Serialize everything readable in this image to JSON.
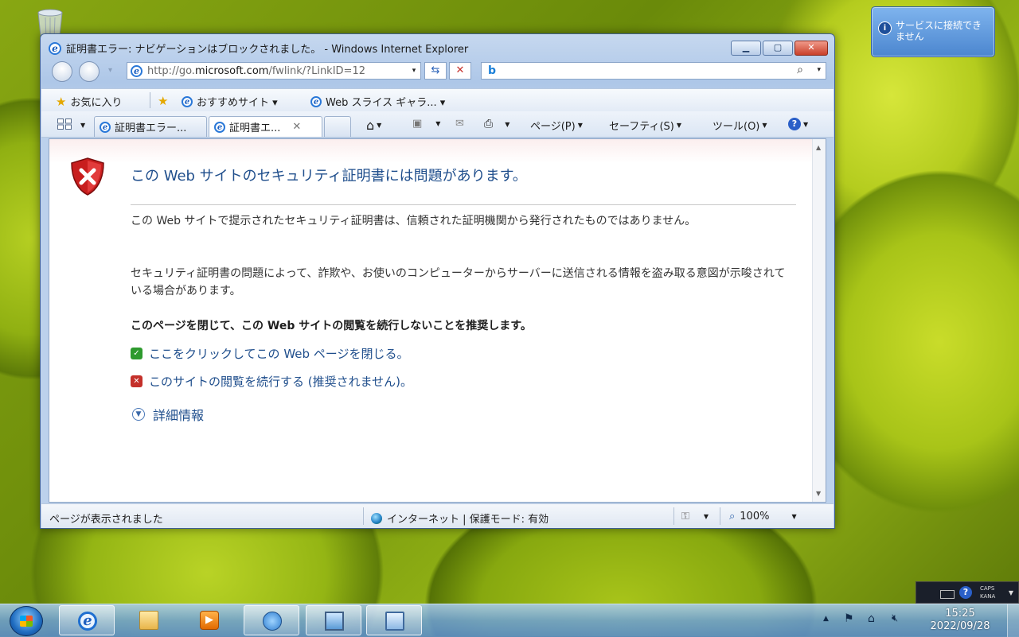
{
  "notification": {
    "text": "サービスに接続できません"
  },
  "window": {
    "title": "証明書エラー: ナビゲーションはブロックされました。 - Windows Internet Explorer",
    "address_prefix": "http://go.",
    "address_domain": "microsoft.com",
    "address_suffix": "/fwlink/?LinkID=12",
    "search_value": ""
  },
  "favorites": {
    "label": "お気に入り",
    "items": [
      "おすすめサイト ▾",
      "Web スライス ギャラ... ▾"
    ]
  },
  "tabs": [
    {
      "label": "証明書エラー..."
    },
    {
      "label": "証明書エ..."
    }
  ],
  "commands": {
    "page": "ページ(P)",
    "safety": "セーフティ(S)",
    "tools": "ツール(O)"
  },
  "page": {
    "heading": "この Web サイトのセキュリティ証明書には問題があります。",
    "para1": "この Web サイトで提示されたセキュリティ証明書は、信頼された証明機関から発行されたものではありません。",
    "para2": "セキュリティ証明書の問題によって、詐欺や、お使いのコンピューターからサーバーに送信される情報を盗み取る意図が示唆されている場合があります。",
    "recommend": "このページを閉じて、この Web サイトの閲覧を続行しないことを推奨します。",
    "link_close": "ここをクリックしてこの Web ページを閉じる。",
    "link_continue": "このサイトの閲覧を続行する (推奨されません)。",
    "more_info": "詳細情報"
  },
  "statusbar": {
    "text": "ページが表示されました",
    "zone": "インターネット | 保護モード: 有効",
    "zoom": "100%"
  },
  "langbar": {
    "caps": "CAPS",
    "kana": "KANA"
  },
  "clock": {
    "time": "15:25",
    "date": "2022/09/28"
  }
}
